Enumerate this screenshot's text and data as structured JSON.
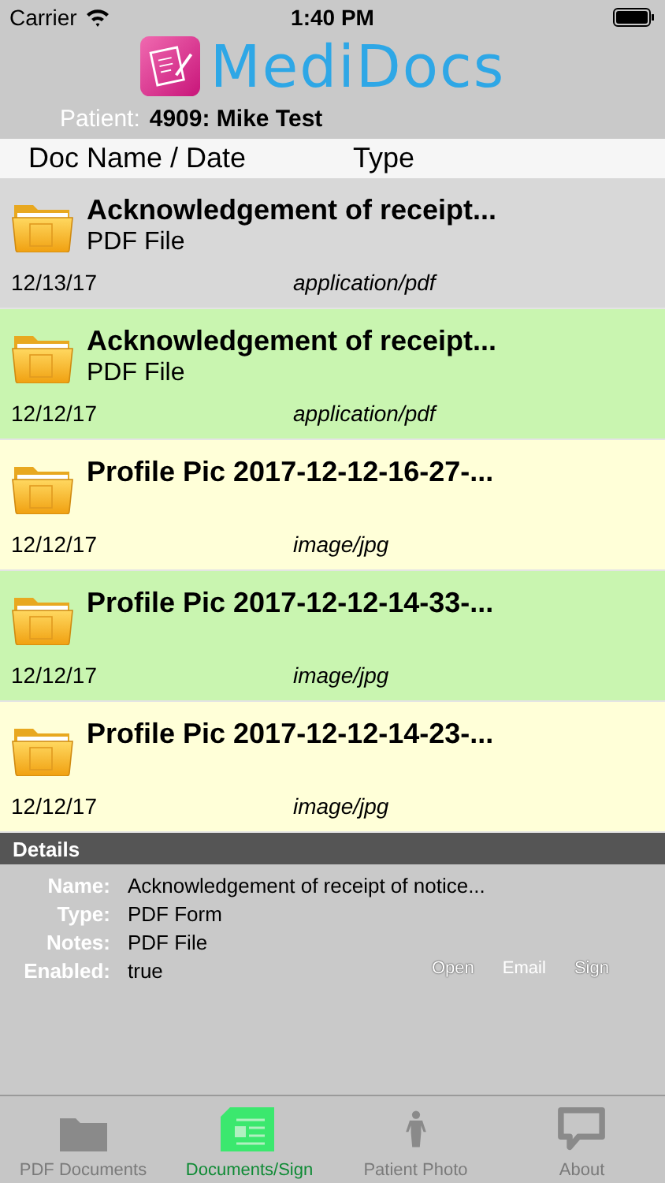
{
  "status_bar": {
    "carrier": "Carrier",
    "time": "1:40 PM"
  },
  "app_title": "MediDocs",
  "patient": {
    "label": "Patient:",
    "value": "4909: Mike Test"
  },
  "columns": [
    "Doc Name / Date",
    "Type"
  ],
  "documents": [
    {
      "name": "Acknowledgement of receipt...",
      "notes": "PDF File",
      "date": "12/13/17",
      "type": "application/pdf",
      "selected": true
    },
    {
      "name": "Acknowledgement of receipt...",
      "notes": "PDF File",
      "date": "12/12/17",
      "type": "application/pdf",
      "selected": false,
      "color": "#c9f5b0"
    },
    {
      "name": "Profile Pic 2017-12-12-16-27-...",
      "date": "12/12/17",
      "type": "image/jpg",
      "selected": false,
      "color": "#ffffd8"
    },
    {
      "name": "Profile Pic 2017-12-12-14-33-...",
      "date": "12/12/17",
      "type": "image/jpg",
      "selected": false,
      "color": "#c9f5b0"
    },
    {
      "name": "Profile Pic 2017-12-12-14-23-...",
      "date": "12/12/17",
      "type": "image/jpg",
      "selected": false,
      "color": "#ffffd8"
    }
  ],
  "details": {
    "title": "Details",
    "fields": [
      {
        "label": "Name:",
        "value": "Acknowledgement of receipt of notice..."
      },
      {
        "label": "Type:",
        "value": "PDF Form"
      },
      {
        "label": "Notes:",
        "value": "PDF File"
      },
      {
        "label": "Enabled:",
        "value": "true"
      }
    ],
    "buttons": [
      "Open",
      "Email",
      "Sign"
    ]
  },
  "tabs": [
    {
      "label": "PDF Documents",
      "kind": "folder",
      "selected": false
    },
    {
      "label": "Documents/Sign",
      "kind": "document",
      "selected": true
    },
    {
      "label": "Patient Photo",
      "kind": "person",
      "selected": false
    },
    {
      "label": "About",
      "kind": "speech",
      "selected": false
    }
  ]
}
